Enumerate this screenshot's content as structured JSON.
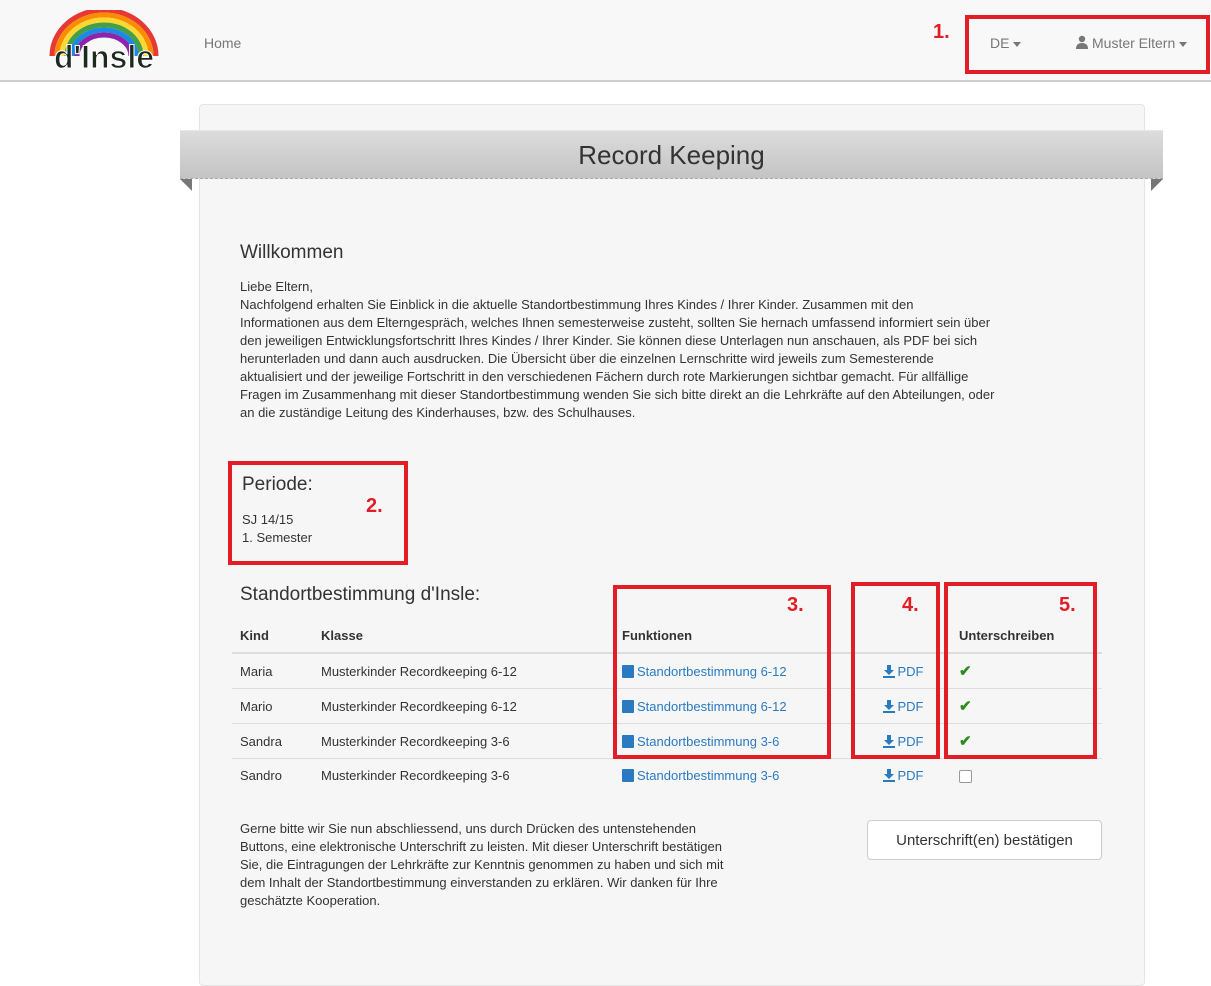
{
  "brand": {
    "logo_text": "d'Insle"
  },
  "nav": {
    "home": "Home",
    "language": "DE",
    "user": "Muster Eltern"
  },
  "annotations": [
    "1.",
    "2.",
    "3.",
    "4.",
    "5."
  ],
  "page": {
    "title": "Record Keeping"
  },
  "welcome": {
    "title": "Willkommen",
    "greeting": "Liebe Eltern,",
    "lines": [
      "Nachfolgend erhalten Sie Einblick in die aktuelle Standortbestimmung Ihres Kindes / Ihrer Kinder. Zusammen mit den",
      "Informationen aus dem Elterngespräch, welches Ihnen semesterweise zusteht, sollten Sie hernach umfassend informiert sein über",
      "den jeweiligen Entwicklungsfortschritt Ihres Kindes / Ihrer Kinder. Sie können diese Unterlagen nun anschauen, als PDF bei sich",
      "herunterladen und dann auch ausdrucken. Die Übersicht über die einzelnen Lernschritte wird jeweils zum Semesterende",
      "aktualisiert und der jeweilige Fortschritt in den verschiedenen Fächern durch rote Markierungen sichtbar gemacht. Für allfällige",
      "Fragen im Zusammenhang mit dieser Standortbestimmung wenden Sie sich bitte direkt an die Lehrkräfte auf den Abteilungen, oder",
      "an die zuständige Leitung des Kinderhauses, bzw. des Schulhauses."
    ]
  },
  "period": {
    "title": "Periode:",
    "year": "SJ 14/15",
    "semester": "1. Semester"
  },
  "records": {
    "title": "Standortbestimmung d'Insle:",
    "headers": {
      "kind": "Kind",
      "klasse": "Klasse",
      "funktionen": "Funktionen",
      "pdf": "",
      "sign": "Unterschreiben"
    },
    "rows": [
      {
        "kind": "Maria",
        "klasse": "Musterkinder Recordkeeping 6-12",
        "link": "Standortbestimmung 6-12",
        "pdf": "PDF",
        "signed": true
      },
      {
        "kind": "Mario",
        "klasse": "Musterkinder Recordkeeping 6-12",
        "link": "Standortbestimmung 6-12",
        "pdf": "PDF",
        "signed": true
      },
      {
        "kind": "Sandra",
        "klasse": "Musterkinder Recordkeeping 3-6",
        "link": "Standortbestimmung 3-6",
        "pdf": "PDF",
        "signed": true
      },
      {
        "kind": "Sandro",
        "klasse": "Musterkinder Recordkeeping 3-6",
        "link": "Standortbestimmung 3-6",
        "pdf": "PDF",
        "signed": false
      }
    ]
  },
  "footer": {
    "lines": [
      "Gerne bitte wir Sie nun abschliessend, uns durch Drücken des untenstehenden",
      "Buttons, eine elektronische Unterschrift zu leisten. Mit dieser Unterschrift bestätigen",
      "Sie, die Eintragungen der Lehrkräfte zur Kenntnis genommen zu haben und sich mit",
      "dem Inhalt der Standortbestimmung einverstanden zu erklären. Wir danken für Ihre",
      "geschätzte Kooperation."
    ],
    "confirm_button": "Unterschrift(en) bestätigen"
  },
  "colors": {
    "annotation": "#e21d25",
    "link": "#2a7ac2",
    "check": "#2e8b1f"
  }
}
